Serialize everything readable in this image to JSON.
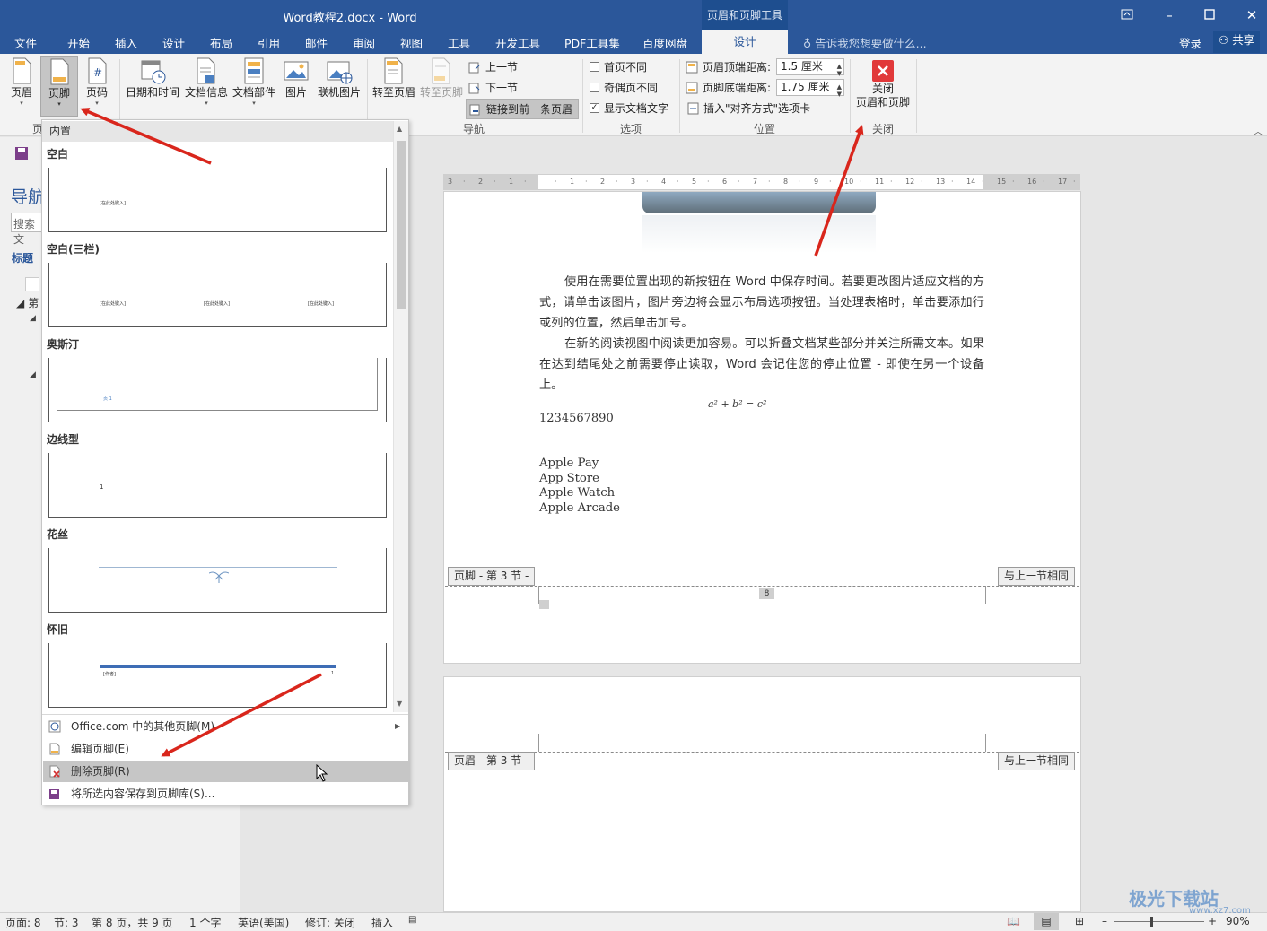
{
  "title_bar": {
    "title": "Word教程2.docx - Word",
    "context_tool": "页眉和页脚工具"
  },
  "tabs": [
    "文件",
    "开始",
    "插入",
    "设计",
    "布局",
    "引用",
    "邮件",
    "审阅",
    "视图",
    "工具",
    "开发工具",
    "PDF工具集",
    "百度网盘"
  ],
  "active_tab": "设计",
  "tell_me": "告诉我您想要做什么...",
  "login": "登录",
  "share": "共享",
  "ribbon": {
    "header": "页眉",
    "footer": "页脚",
    "page_number": "页码",
    "date_time": "日期和时间",
    "doc_info": "文档信息",
    "doc_parts": "文档部件",
    "picture": "图片",
    "online_picture": "联机图片",
    "goto_header": "转至页眉",
    "goto_footer": "转至页脚",
    "prev_section": "上一节",
    "next_section": "下一节",
    "link_previous": "链接到前一条页眉",
    "group_nav": "导航",
    "diff_first": "首页不同",
    "diff_odd_even": "奇偶页不同",
    "show_doc_text": "显示文档文字",
    "group_options": "选项",
    "header_top_label": "页眉顶端距离:",
    "header_top_value": "1.5 厘米",
    "footer_bottom_label": "页脚底端距离:",
    "footer_bottom_value": "1.75 厘米",
    "insert_align_tab": "插入\"对齐方式\"选项卡",
    "group_position": "位置",
    "close_line1": "关闭",
    "close_line2": "页眉和页脚",
    "group_close": "关闭",
    "group_hf_partial": "页"
  },
  "nav_pane": {
    "title_partial": "导航",
    "search_partial": "搜索文",
    "headings_tab": "标题",
    "item_partial": "第"
  },
  "dropdown": {
    "section_header": "内置",
    "gallery": [
      {
        "name": "空白",
        "placeholders": [
          "[在此处键入]"
        ]
      },
      {
        "name": "空白(三栏)",
        "placeholders": [
          "[在此处键入]",
          "[在此处键入]",
          "[在此处键入]"
        ]
      },
      {
        "name": "奥斯汀",
        "placeholders": [
          "页 1"
        ]
      },
      {
        "name": "边线型",
        "placeholders": [
          "1"
        ]
      },
      {
        "name": "花丝",
        "placeholders": []
      },
      {
        "name": "怀旧",
        "placeholders": [
          "[作者]",
          "1"
        ]
      }
    ],
    "menu": {
      "more_office": "Office.com 中的其他页脚(M)",
      "edit_footer": "编辑页脚(E)",
      "remove_footer": "删除页脚(R)",
      "save_selection": "将所选内容保存到页脚库(S)..."
    }
  },
  "ruler_ticks": [
    "3",
    "2",
    "1",
    "",
    "1",
    "2",
    "3",
    "4",
    "5",
    "6",
    "7",
    "8",
    "9",
    "10",
    "11",
    "12",
    "13",
    "14",
    "15",
    "16",
    "17"
  ],
  "document": {
    "para1": "使用在需要位置出现的新按钮在 Word 中保存时间。若要更改图片适应文档的方式，请单击该图片，图片旁边将会显示布局选项按钮。当处理表格时，单击要添加行或列的位置，然后单击加号。",
    "para2": "在新的阅读视图中阅读更加容易。可以折叠文档某些部分并关注所需文本。如果在达到结尾处之前需要停止读取，Word 会记住您的停止位置 - 即使在另一个设备上。",
    "formula": "a² + b² = c²",
    "number": "1234567890",
    "list": [
      "Apple Pay",
      "App Store",
      "Apple Watch",
      "Apple Arcade"
    ],
    "footer_label": "页脚 - 第 3 节 -",
    "same_as_prev": "与上一节相同",
    "page_num": "8",
    "header_label": "页眉 - 第 3 节 -"
  },
  "status": {
    "page": "页面: 8",
    "section": "节: 3",
    "page_of": "第 8 页，共 9 页",
    "words": "1 个字",
    "lang": "英语(美国)",
    "track": "修订: 关闭",
    "insert": "插入",
    "zoom": "90%"
  },
  "watermark": "极光下载站",
  "watermark_url": "www.xz7.com",
  "colors": {
    "accent": "#2b579a",
    "arrow": "#d9261c",
    "close_red": "#e1393a"
  }
}
